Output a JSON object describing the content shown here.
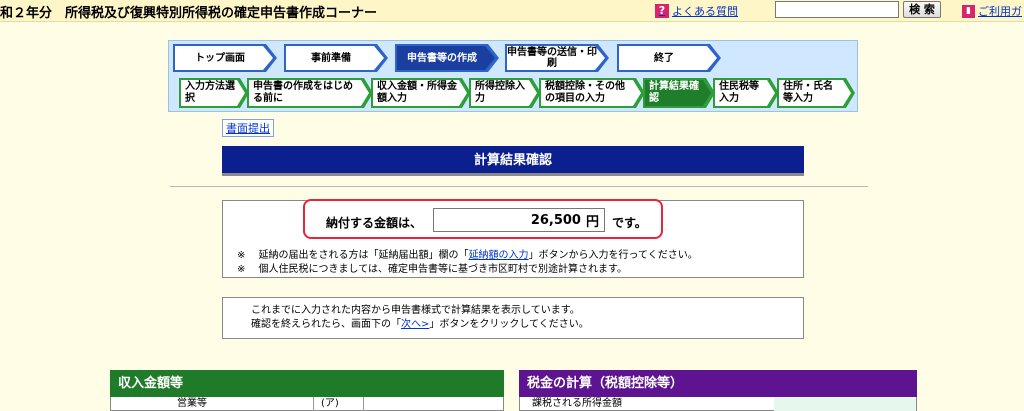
{
  "header": {
    "title": "和２年分　所得税及び復興特別所得税の確定申告書作成コーナー",
    "faq_label": "よくある質問",
    "search_value": "",
    "search_button": "検 索",
    "guide_label": "ご利用ガ"
  },
  "steps": {
    "main": [
      {
        "label": "トップ画面"
      },
      {
        "label": "事前準備"
      },
      {
        "label": "申告書等の作成"
      },
      {
        "label": "申告書等の送信・印刷"
      },
      {
        "label": "終了"
      }
    ],
    "sub": [
      {
        "label": "入力方法選択"
      },
      {
        "label": "申告書の作成をはじめる前に"
      },
      {
        "label": "収入金額・所得金額入力"
      },
      {
        "label": "所得控除入力"
      },
      {
        "label": "税額控除・その他の項目の入力"
      },
      {
        "label": "計算結果確認"
      },
      {
        "label": "住民税等入力"
      },
      {
        "label": "住所・氏名等入力"
      }
    ]
  },
  "submit_link": "書面提出",
  "section_title": "計算結果確認",
  "result": {
    "label": "納付する金額は、",
    "amount": "26,500",
    "unit": "円",
    "suffix": "です。",
    "note1_a": "※　 延納の届出をされる方は「延納届出額」欄の「",
    "note1_link": "延納額の入力",
    "note1_b": "」ボタンから入力を行ってください。",
    "note2": "※　 個人住民税につきましては、確定申告書等に基づき市区町村で別途計算されます。"
  },
  "info": {
    "line1": "これまでに入力された内容から申告書様式で計算結果を表示しています。",
    "line2_a": "確認を終えられたら、画面下の「",
    "line2_link": "次へ>",
    "line2_b": "」ボタンをクリックしてください。"
  },
  "panels": {
    "income_title": "収入金額等",
    "income_row_label": "営業等",
    "income_row_code": "(ア)",
    "tax_title": "税金の計算（税額控除等）",
    "tax_row_label": "課税される所得金額"
  },
  "colors": {
    "income_header": "#1f7a2a",
    "tax_header": "#5e1491",
    "section_title": "#0c1f8f",
    "highlight": "#e8243c"
  }
}
